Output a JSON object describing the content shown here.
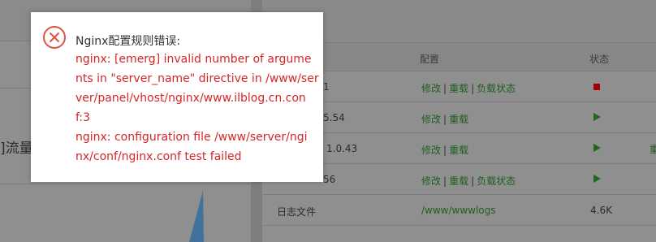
{
  "left_panel": {
    "traffic_label": "]流量"
  },
  "table": {
    "headers": {
      "config": "配置",
      "status": "状态"
    },
    "rows": [
      {
        "name": "1",
        "links": [
          "修改",
          "重载",
          "负载状态"
        ],
        "status": "stopped"
      },
      {
        "name": "5.54",
        "links": [
          "修改",
          "重载"
        ],
        "status": "running"
      },
      {
        "name": "1.0.43",
        "links": [
          "修改",
          "重载"
        ],
        "status": "running"
      },
      {
        "name": "56",
        "links": [
          "修改",
          "重载",
          "负载状态"
        ],
        "status": "running"
      },
      {
        "name": "日志文件",
        "path": "/www/wwwlogs",
        "size": "4.6K"
      }
    ],
    "edge_text": "重"
  },
  "dialog": {
    "icon": "error-circle-x-icon",
    "title": "Nginx配置规则错误:",
    "message_lines": [
      "nginx: [emerg] invalid number of argume",
      "nts in \"server_name\" directive in /www/ser",
      "ver/panel/vhost/nginx/www.ilblog.cn.con",
      "f:3",
      "nginx: configuration file /www/server/ngi",
      "nx/conf/nginx.conf test failed"
    ]
  },
  "colors": {
    "error_red": "#d52626",
    "link_green": "#1f5f1f",
    "overlay_gray": "#8f8f8f"
  }
}
